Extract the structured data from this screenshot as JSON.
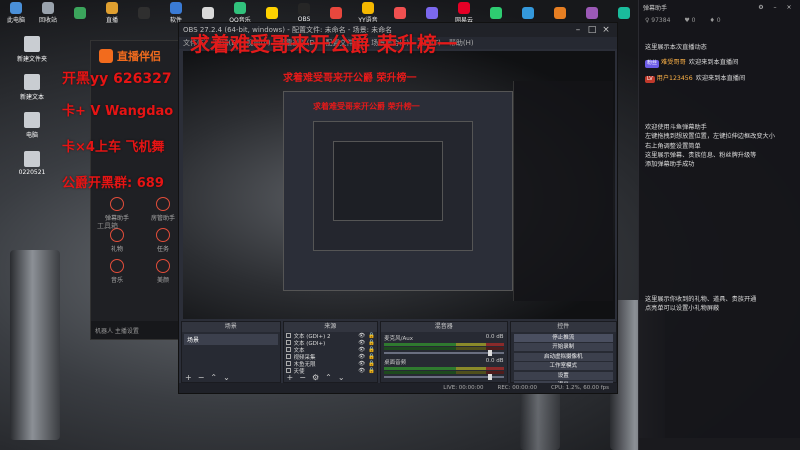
{
  "desktop": {
    "taskbar_icons": [
      {
        "label": "此电脑",
        "color": "#4a90d9"
      },
      {
        "label": "回收站",
        "color": "#9aa3ad"
      },
      {
        "label": "",
        "color": "#3ba55c"
      },
      {
        "label": "直播",
        "color": "#e0a030"
      },
      {
        "label": "",
        "color": "#2f2f2f"
      },
      {
        "label": "软件",
        "color": "#3a7bd5"
      },
      {
        "label": "",
        "color": "#d9d9d9"
      },
      {
        "label": "QQ音乐",
        "color": "#31c27c"
      },
      {
        "label": "",
        "color": "#ffd200"
      },
      {
        "label": "OBS",
        "color": "#262626"
      },
      {
        "label": "",
        "color": "#e8473d"
      },
      {
        "label": "YY语音",
        "color": "#f5b800"
      },
      {
        "label": "",
        "color": "#f05050"
      },
      {
        "label": "",
        "color": "#7b68ee"
      },
      {
        "label": "网易云",
        "color": "#e60026"
      },
      {
        "label": "",
        "color": "#2ecc71"
      },
      {
        "label": "",
        "color": "#3498db"
      },
      {
        "label": "",
        "color": "#e67e22"
      },
      {
        "label": "",
        "color": "#9b59b6"
      },
      {
        "label": "",
        "color": "#1abc9c"
      }
    ],
    "left_icons": [
      {
        "label": "新建文件夹"
      },
      {
        "label": "新建文本"
      },
      {
        "label": "电脑"
      },
      {
        "label": "0220521"
      }
    ]
  },
  "overlay": {
    "title": "求着难受哥来开公爵 荣升榜一",
    "line1": "开黑yy  626327",
    "line2": "卡+ V Wangdao",
    "line3": "卡×4上车 飞机舞",
    "line4": "公爵开黑群: 689"
  },
  "streamer_app": {
    "logo": "直播伴侣",
    "section_label": "工具箱",
    "tools": [
      {
        "label": "弹幕助手"
      },
      {
        "label": "房管助手"
      },
      {
        "label": "礼物"
      },
      {
        "label": "任务"
      },
      {
        "label": "音乐"
      },
      {
        "label": "美颜"
      }
    ],
    "bottom_text": "机器人 主播设置"
  },
  "obs": {
    "title": "OBS 27.2.4 (64-bit, windows) - 配置文件: 未命名 - 场景: 未命名",
    "menu": [
      "文件(F)",
      "编辑(E)",
      "视图(V)",
      "停靠部件(D)",
      "配置文件(P)",
      "场景集合(S)",
      "工具(T)",
      "帮助(H)"
    ],
    "preview_overlay": "求着难受哥来开公爵 荣升榜一",
    "docks": {
      "scenes_header": "场景",
      "sources_header": "来源",
      "mixer_header": "混音器",
      "controls_header": "控件"
    },
    "scenes": [
      "场景"
    ],
    "sources": [
      {
        "name": "文本 (GDI+) 2"
      },
      {
        "name": "文本 (GDI+)"
      },
      {
        "name": "文本"
      },
      {
        "name": "视频采集"
      },
      {
        "name": "木鱼无限"
      },
      {
        "name": "天使"
      }
    ],
    "mixer": [
      {
        "name": "麦克风/Aux",
        "db": "0.0 dB"
      },
      {
        "name": "桌面音频",
        "db": "0.0 dB"
      }
    ],
    "controls": [
      {
        "label": "停止推流",
        "active": true
      },
      {
        "label": "开始录制",
        "active": false
      },
      {
        "label": "启动虚拟摄像机",
        "active": false
      },
      {
        "label": "工作室模式",
        "active": false
      },
      {
        "label": "设置",
        "active": false
      },
      {
        "label": "退出",
        "active": false
      }
    ],
    "status": {
      "live": "LIVE: 00:00:00",
      "rec": "REC: 00:00:00",
      "cpu": "CPU: 1.2%, 60.00 fps"
    },
    "add_icon": "+",
    "remove_icon": "−"
  },
  "chat": {
    "title": "弹幕助手",
    "stats": [
      "♀ 97384",
      "♥ 0",
      "♦ 0"
    ],
    "system_top": "这里展示本次直播动态",
    "messages": [
      {
        "badge": "粉丝",
        "badge_color": "#6c5ce7",
        "user": "难受哥哥",
        "text": "欢迎来到本直播间"
      },
      {
        "badge": "LV",
        "badge_color": "#c0392b",
        "user": "用户123456",
        "text": "欢迎来到本直播间"
      }
    ],
    "system_middle": "欢迎使用斗鱼弹幕助手\n左键拖拽到想放置位置，左键拉伸边框改变大小\n右上角调整设置简单\n这里展示弹幕、贵族信息、粉丝牌升级等\n添加弹幕助手成功",
    "system_bottom": "这里展示你收到的礼物、道具、贵族开通\n点亮单可以设置小礼物屏蔽"
  }
}
